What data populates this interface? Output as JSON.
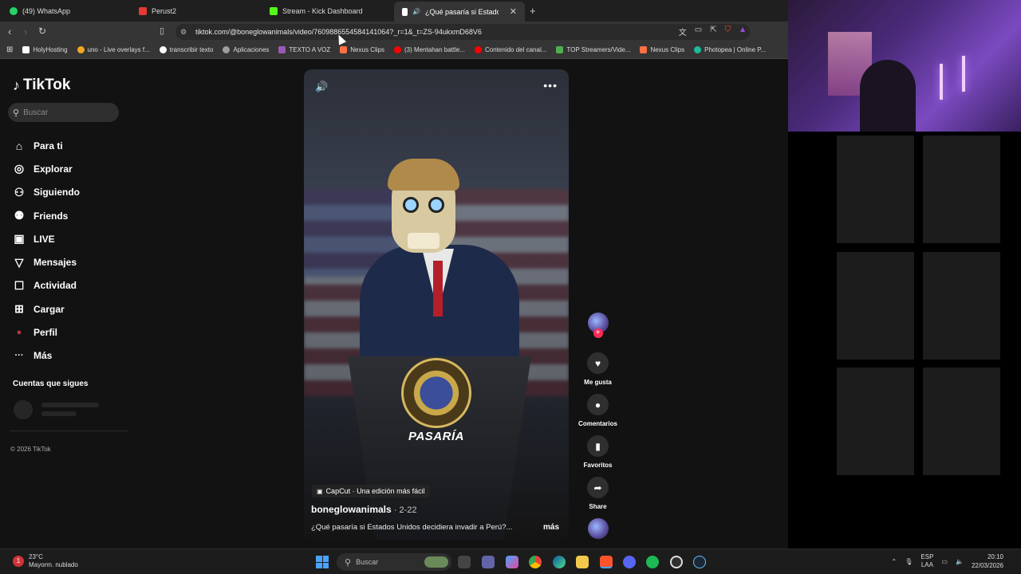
{
  "browser": {
    "tabs": [
      {
        "label": "(49) WhatsApp",
        "color": "#25d366"
      },
      {
        "label": "Perust2",
        "color": "#e53935"
      },
      {
        "label": "Stream - Kick Dashboard",
        "color": "#53fc18"
      },
      {
        "label": "¿Qué pasaría si Estados Unid",
        "color": "#ffffff",
        "active": true
      }
    ],
    "url": "tiktok.com/@boneglowanimals/video/7609886554584141064?_r=1&_t=ZS-94ukxmD68V6",
    "bookmarks": [
      {
        "label": "HolyHosting",
        "color": "#ffffff"
      },
      {
        "label": "uno - Live overlays f...",
        "color": "#f5a623"
      },
      {
        "label": "transcribir texto",
        "color": "#ffffff"
      },
      {
        "label": "Aplicaciones",
        "color": "#9e9e9e"
      },
      {
        "label": "TEXTO A VOZ",
        "color": "#9b59b6"
      },
      {
        "label": "Nexus Clips",
        "color": "#ff7043"
      },
      {
        "label": "(3) Mentahan battle...",
        "color": "#ff0000"
      },
      {
        "label": "Contenido del canal...",
        "color": "#ff0000"
      },
      {
        "label": "TOP Streamers/Vide...",
        "color": "#4caf50"
      },
      {
        "label": "Nexus Clips",
        "color": "#ff7043"
      },
      {
        "label": "Photopea | Online P...",
        "color": "#1abc9c"
      }
    ]
  },
  "tiktok": {
    "logo": "TikTok",
    "search_placeholder": "Buscar",
    "nav": [
      {
        "label": "Para ti",
        "icon": "home-icon",
        "glyph": "⌂"
      },
      {
        "label": "Explorar",
        "icon": "compass-icon",
        "glyph": "◎"
      },
      {
        "label": "Siguiendo",
        "icon": "user-follow-icon",
        "glyph": "⚇"
      },
      {
        "label": "Friends",
        "icon": "friends-icon",
        "glyph": "⚉"
      },
      {
        "label": "LIVE",
        "icon": "live-icon",
        "glyph": "▣"
      },
      {
        "label": "Mensajes",
        "icon": "send-icon",
        "glyph": "▽"
      },
      {
        "label": "Actividad",
        "icon": "activity-icon",
        "glyph": "☐"
      },
      {
        "label": "Cargar",
        "icon": "upload-icon",
        "glyph": "⊞"
      },
      {
        "label": "Perfil",
        "icon": "profile-avatar-icon",
        "glyph": "●"
      },
      {
        "label": "Más",
        "icon": "more-icon",
        "glyph": "···"
      }
    ],
    "following_title": "Cuentas que sigues",
    "copyright": "© 2026 TikTok",
    "video": {
      "overlay_text": "PASARÍA",
      "capcut_badge": "CapCut · Una edición más fácil",
      "author": "boneglowanimals",
      "date": " · 2-22",
      "caption": "¿Qué pasaría si Estados Unidos decidiera invadir a Perú?...",
      "more": "más"
    },
    "actions": {
      "like": "Me gusta",
      "comments": "Comentarios",
      "favorites": "Favoritos",
      "share": "Share"
    }
  },
  "taskbar": {
    "weather_temp": "23°C",
    "weather_desc": "Mayorm. nublado",
    "weather_badge": "1",
    "search": "Buscar",
    "lang_top": "ESP",
    "lang_bottom": "LAA",
    "time": "20:10",
    "date": "22/03/2026"
  }
}
